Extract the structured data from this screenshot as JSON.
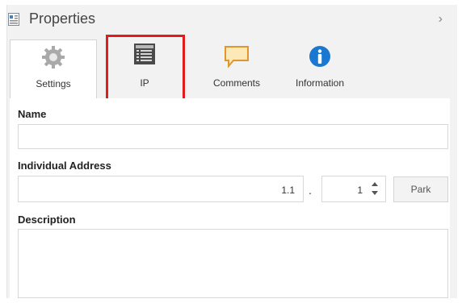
{
  "header": {
    "title": "Properties",
    "title_icon": "properties-icon",
    "collapse_glyph": "›",
    "collapse_icon": "chevron-right-icon"
  },
  "tabs": [
    {
      "label": "Settings",
      "icon": "gear-icon",
      "active": true
    },
    {
      "label": "IP",
      "icon": "ip-config-icon",
      "active": false,
      "highlighted": true
    },
    {
      "label": "Comments",
      "icon": "comment-icon",
      "active": false
    },
    {
      "label": "Information",
      "icon": "info-icon",
      "active": false
    }
  ],
  "form": {
    "name_label": "Name",
    "name_value": "",
    "address_label": "Individual Address",
    "address_prefix": "1.1",
    "address_separator": ".",
    "address_device": "1",
    "park_label": "Park",
    "description_label": "Description",
    "description_value": ""
  },
  "colors": {
    "highlight": "#e21b1b",
    "info_blue": "#1b78d0",
    "comment_orange": "#f0a030"
  }
}
